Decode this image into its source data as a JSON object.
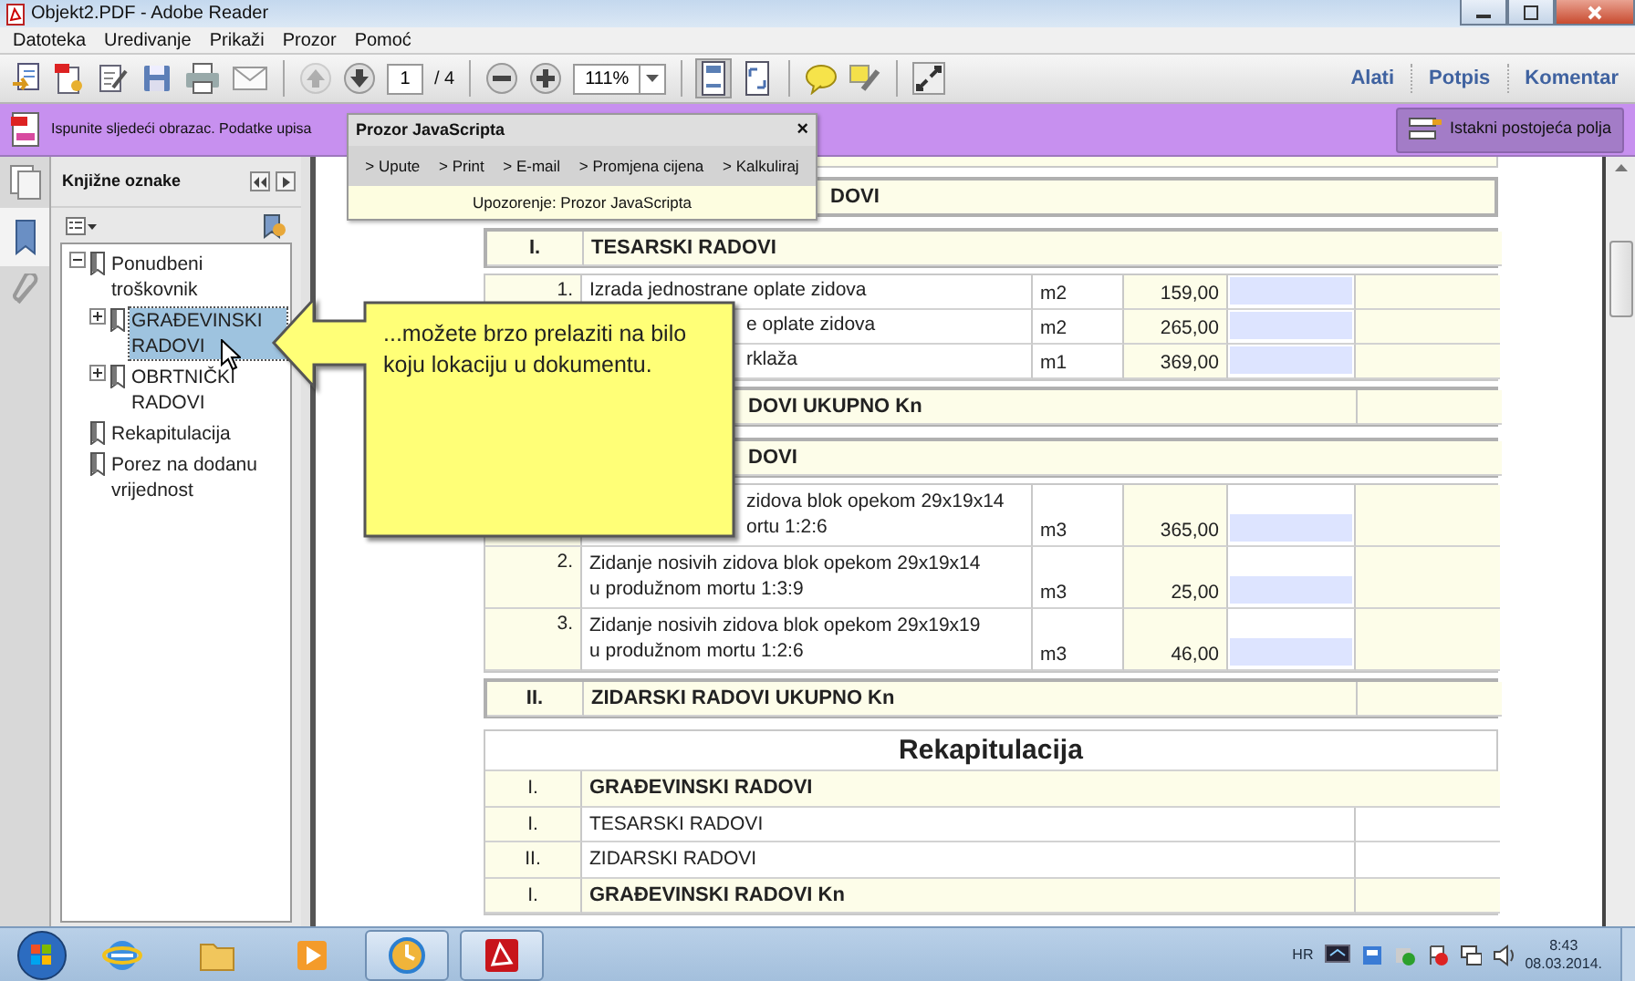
{
  "window": {
    "title": "Objekt2.PDF - Adobe Reader"
  },
  "menu": [
    "Datoteka",
    "Uredivanje",
    "Prikaži",
    "Prozor",
    "Pomoć"
  ],
  "toolbar": {
    "prev_page": {
      "disabled": true
    },
    "next_page": {
      "disabled": false
    },
    "page": "1",
    "page_count": "/ 4",
    "zoom": "111%",
    "fit_page": {
      "selected": true
    },
    "panels": [
      "Alati",
      "Potpis",
      "Komentar"
    ]
  },
  "form_bar": {
    "message": "Ispunite sljedeći obrazac. Podatke upisa",
    "button": "Istakni postojeća polja"
  },
  "js_window": {
    "title": "Prozor JavaScripta",
    "close": "×",
    "links": [
      "> Upute",
      "> Print",
      "> E-mail",
      "> Promjena cijena",
      "> Kalkuliraj"
    ],
    "warning": "Upozorenje: Prozor JavaScripta"
  },
  "nav_panels": [
    {
      "kind": "pages",
      "selected": false
    },
    {
      "kind": "bookmarks",
      "selected": true
    },
    {
      "kind": "attachments",
      "selected": false
    }
  ],
  "bookmarks": {
    "title": "Knjižne oznake",
    "items": [
      {
        "label": "Ponudbeni troškovnik",
        "expanded": true,
        "selected": false,
        "children": [
          {
            "label": "GRAĐEVINSKI RADOVI",
            "expanded": false,
            "selected": true
          },
          {
            "label": "OBRTNIČKI RADOVI",
            "expanded": false,
            "selected": false
          }
        ]
      },
      {
        "label": "Rekapitulacija",
        "selected": false
      },
      {
        "label": "Porez na dodanu vrijednost",
        "selected": false
      }
    ]
  },
  "callout": {
    "text": "...možete brzo prelaziti na bilo koju lokaciju u dokumentu."
  },
  "document": {
    "blocks": [
      {
        "kind": "heading",
        "text": "DOVI",
        "partly_hidden": true
      },
      {
        "kind": "group",
        "number": "I.",
        "title": "TESARSKI RADOVI",
        "partly_hidden": false
      },
      {
        "kind": "items",
        "rows": [
          {
            "number": "1.",
            "lines": [
              "Izrada jednostrane oplate zidova"
            ],
            "partly_hidden": false,
            "unit": "m2",
            "quantity": "159,00"
          },
          {
            "lines": [
              "e oplate zidova"
            ],
            "partly_hidden": true,
            "unit": "m2",
            "quantity": "265,00"
          },
          {
            "lines": [
              "rklaža"
            ],
            "partly_hidden": true,
            "unit": "m1",
            "quantity": "369,00"
          }
        ]
      },
      {
        "kind": "total",
        "text": "DOVI UKUPNO Kn",
        "partly_hidden": true
      },
      {
        "kind": "group",
        "title": "DOVI",
        "partly_hidden": true
      },
      {
        "kind": "items",
        "rows": [
          {
            "lines": [
              "zidova blok opekom 29x19x14",
              "ortu 1:2:6"
            ],
            "partly_hidden": true,
            "unit": "m3",
            "quantity": "365,00"
          },
          {
            "number": "2.",
            "lines": [
              "Zidanje nosivih zidova blok opekom 29x19x14",
              "u produžnom mortu 1:3:9"
            ],
            "partly_hidden": false,
            "unit": "m3",
            "quantity": "25,00"
          },
          {
            "number": "3.",
            "lines": [
              "Zidanje nosivih zidova blok opekom 29x19x19",
              "u produžnom mortu 1:2:6"
            ],
            "partly_hidden": false,
            "unit": "m3",
            "quantity": "46,00"
          }
        ]
      },
      {
        "kind": "total",
        "number": "II.",
        "text": "ZIDARSKI RADOVI UKUPNO Kn",
        "partly_hidden": false
      },
      {
        "kind": "summary",
        "title": "Rekapitulacija",
        "rows": [
          {
            "kind": "heading",
            "number": "I.",
            "text": "GRAĐEVINSKI RADOVI"
          },
          {
            "kind": "line",
            "number": "I.",
            "text": "TESARSKI RADOVI"
          },
          {
            "kind": "line",
            "number": "II.",
            "text": "ZIDARSKI RADOVI"
          },
          {
            "kind": "total",
            "number": "I.",
            "text": "GRAĐEVINSKI RADOVI Kn"
          }
        ]
      }
    ]
  },
  "taskbar": {
    "apps": [
      {
        "kind": "browser",
        "active": false
      },
      {
        "kind": "folder",
        "active": false
      },
      {
        "kind": "media",
        "active": false
      },
      {
        "kind": "gadget",
        "active": true
      },
      {
        "kind": "pdf",
        "active": true
      }
    ],
    "language": "HR",
    "time": "8:43",
    "date": "08.03.2014."
  }
}
